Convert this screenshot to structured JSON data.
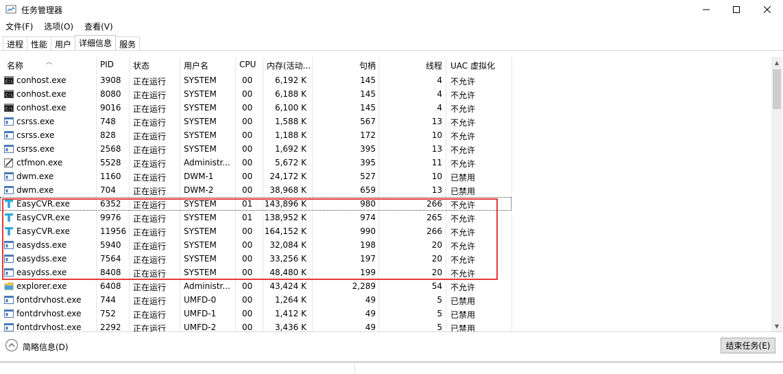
{
  "window": {
    "title": "任务管理器"
  },
  "menu": [
    "文件(F)",
    "选项(O)",
    "查看(V)"
  ],
  "tabs": [
    {
      "label": "进程",
      "active": false
    },
    {
      "label": "性能",
      "active": false
    },
    {
      "label": "用户",
      "active": false
    },
    {
      "label": "详细信息",
      "active": true
    },
    {
      "label": "服务",
      "active": false
    }
  ],
  "table": {
    "columns": [
      "名称",
      "PID",
      "状态",
      "用户名",
      "CPU",
      "内存(活动...",
      "句柄",
      "线程",
      "UAC 虚拟化"
    ],
    "rows": [
      {
        "icon": "console-icon",
        "name": "conhost.exe",
        "pid": "3908",
        "status": "正在运行",
        "user": "SYSTEM",
        "cpu": "00",
        "mem": "6,192 K",
        "handles": "145",
        "threads": "4",
        "uac": "不允许"
      },
      {
        "icon": "console-icon",
        "name": "conhost.exe",
        "pid": "8080",
        "status": "正在运行",
        "user": "SYSTEM",
        "cpu": "00",
        "mem": "6,188 K",
        "handles": "145",
        "threads": "4",
        "uac": "不允许"
      },
      {
        "icon": "console-icon",
        "name": "conhost.exe",
        "pid": "9016",
        "status": "正在运行",
        "user": "SYSTEM",
        "cpu": "00",
        "mem": "6,100 K",
        "handles": "145",
        "threads": "4",
        "uac": "不允许"
      },
      {
        "icon": "app-window-icon",
        "name": "csrss.exe",
        "pid": "748",
        "status": "正在运行",
        "user": "SYSTEM",
        "cpu": "00",
        "mem": "1,588 K",
        "handles": "567",
        "threads": "13",
        "uac": "不允许"
      },
      {
        "icon": "app-window-icon",
        "name": "csrss.exe",
        "pid": "828",
        "status": "正在运行",
        "user": "SYSTEM",
        "cpu": "00",
        "mem": "1,188 K",
        "handles": "172",
        "threads": "10",
        "uac": "不允许"
      },
      {
        "icon": "app-window-icon",
        "name": "csrss.exe",
        "pid": "2568",
        "status": "正在运行",
        "user": "SYSTEM",
        "cpu": "00",
        "mem": "1,692 K",
        "handles": "395",
        "threads": "13",
        "uac": "不允许"
      },
      {
        "icon": "pen-icon",
        "name": "ctfmon.exe",
        "pid": "5528",
        "status": "正在运行",
        "user": "Administr...",
        "cpu": "00",
        "mem": "5,672 K",
        "handles": "395",
        "threads": "11",
        "uac": "不允许"
      },
      {
        "icon": "app-window-icon",
        "name": "dwm.exe",
        "pid": "1160",
        "status": "正在运行",
        "user": "DWM-1",
        "cpu": "00",
        "mem": "24,172 K",
        "handles": "527",
        "threads": "10",
        "uac": "已禁用"
      },
      {
        "icon": "app-window-icon",
        "name": "dwm.exe",
        "pid": "704",
        "status": "正在运行",
        "user": "DWM-2",
        "cpu": "00",
        "mem": "38,968 K",
        "handles": "659",
        "threads": "13",
        "uac": "已禁用"
      },
      {
        "icon": "t-logo-icon",
        "name": "EasyCVR.exe",
        "pid": "6352",
        "status": "正在运行",
        "user": "SYSTEM",
        "cpu": "01",
        "mem": "143,896 K",
        "handles": "980",
        "threads": "266",
        "uac": "不允许"
      },
      {
        "icon": "t-logo-icon",
        "name": "EasyCVR.exe",
        "pid": "9976",
        "status": "正在运行",
        "user": "SYSTEM",
        "cpu": "01",
        "mem": "138,952 K",
        "handles": "974",
        "threads": "265",
        "uac": "不允许"
      },
      {
        "icon": "t-logo-icon",
        "name": "EasyCVR.exe",
        "pid": "11956",
        "status": "正在运行",
        "user": "SYSTEM",
        "cpu": "00",
        "mem": "164,152 K",
        "handles": "990",
        "threads": "266",
        "uac": "不允许"
      },
      {
        "icon": "app-window-icon",
        "name": "easydss.exe",
        "pid": "5940",
        "status": "正在运行",
        "user": "SYSTEM",
        "cpu": "00",
        "mem": "32,084 K",
        "handles": "198",
        "threads": "20",
        "uac": "不允许"
      },
      {
        "icon": "app-window-icon",
        "name": "easydss.exe",
        "pid": "7564",
        "status": "正在运行",
        "user": "SYSTEM",
        "cpu": "00",
        "mem": "33,256 K",
        "handles": "197",
        "threads": "20",
        "uac": "不允许"
      },
      {
        "icon": "app-window-icon",
        "name": "easydss.exe",
        "pid": "8408",
        "status": "正在运行",
        "user": "SYSTEM",
        "cpu": "00",
        "mem": "48,480 K",
        "handles": "199",
        "threads": "20",
        "uac": "不允许"
      },
      {
        "icon": "folder-icon",
        "name": "explorer.exe",
        "pid": "6408",
        "status": "正在运行",
        "user": "Administr...",
        "cpu": "00",
        "mem": "43,424 K",
        "handles": "2,289",
        "threads": "54",
        "uac": "不允许"
      },
      {
        "icon": "app-window-icon",
        "name": "fontdrvhost.exe",
        "pid": "744",
        "status": "正在运行",
        "user": "UMFD-0",
        "cpu": "00",
        "mem": "1,264 K",
        "handles": "49",
        "threads": "5",
        "uac": "已禁用"
      },
      {
        "icon": "app-window-icon",
        "name": "fontdrvhost.exe",
        "pid": "752",
        "status": "正在运行",
        "user": "UMFD-1",
        "cpu": "00",
        "mem": "1,412 K",
        "handles": "49",
        "threads": "5",
        "uac": "已禁用"
      },
      {
        "icon": "app-window-icon",
        "name": "fontdrvhost.exe",
        "pid": "2292",
        "status": "正在运行",
        "user": "UMFD-2",
        "cpu": "00",
        "mem": "3,436 K",
        "handles": "49",
        "threads": "5",
        "uac": "已禁用"
      }
    ]
  },
  "footer": {
    "brief_label": "简略信息(D)",
    "end_task_label": "结束任务(E)"
  },
  "colors": {
    "highlight": "#e53935"
  }
}
